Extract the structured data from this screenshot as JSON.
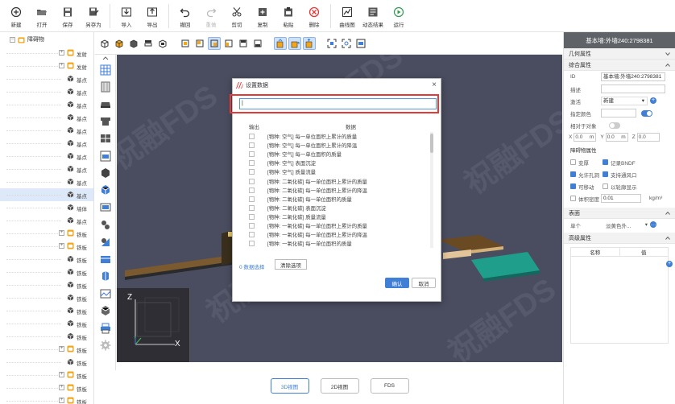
{
  "toolbar": [
    {
      "label": "新建",
      "icon": "plus-circle-icon",
      "disabled": false
    },
    {
      "label": "打开",
      "icon": "folder-open-icon",
      "disabled": false
    },
    {
      "label": "保存",
      "icon": "save-icon",
      "disabled": false
    },
    {
      "label": "另存为",
      "icon": "save-as-icon",
      "disabled": false
    },
    {
      "label": "导入",
      "icon": "import-icon",
      "disabled": false
    },
    {
      "label": "导出",
      "icon": "export-icon",
      "disabled": false
    },
    {
      "label": "撤回",
      "icon": "undo-icon",
      "disabled": false
    },
    {
      "label": "重做",
      "icon": "redo-icon",
      "disabled": true
    },
    {
      "label": "剪切",
      "icon": "scissors-icon",
      "disabled": false
    },
    {
      "label": "复制",
      "icon": "copy-icon",
      "disabled": false
    },
    {
      "label": "粘贴",
      "icon": "paste-icon",
      "disabled": false
    },
    {
      "label": "删除",
      "icon": "delete-icon",
      "disabled": false
    },
    {
      "label": "曲线图",
      "icon": "line-chart-icon",
      "disabled": false
    },
    {
      "label": "动态结果",
      "icon": "dynamic-result-icon",
      "disabled": false
    },
    {
      "label": "运行",
      "icon": "play-icon",
      "disabled": false
    }
  ],
  "tree": {
    "root_label": "障碍物",
    "rows": [
      {
        "label": "发射",
        "kind": "group"
      },
      {
        "label": "发射",
        "kind": "group"
      },
      {
        "label": "基点",
        "kind": "item"
      },
      {
        "label": "基点",
        "kind": "item"
      },
      {
        "label": "基点",
        "kind": "item"
      },
      {
        "label": "基点",
        "kind": "item"
      },
      {
        "label": "基点",
        "kind": "item"
      },
      {
        "label": "基点",
        "kind": "item"
      },
      {
        "label": "基点",
        "kind": "item"
      },
      {
        "label": "基点",
        "kind": "item"
      },
      {
        "label": "基点",
        "kind": "item"
      },
      {
        "label": "基点",
        "kind": "item"
      },
      {
        "label": "墙体",
        "kind": "item"
      },
      {
        "label": "基点",
        "kind": "item"
      },
      {
        "label": "铁板",
        "kind": "group"
      },
      {
        "label": "铁板",
        "kind": "group"
      },
      {
        "label": "铁板",
        "kind": "item"
      },
      {
        "label": "铁板",
        "kind": "item"
      },
      {
        "label": "铁板",
        "kind": "item"
      },
      {
        "label": "铁板",
        "kind": "item"
      },
      {
        "label": "铁板",
        "kind": "item"
      },
      {
        "label": "铁板",
        "kind": "item"
      },
      {
        "label": "铁板",
        "kind": "item"
      },
      {
        "label": "铁板",
        "kind": "group"
      },
      {
        "label": "铁板",
        "kind": "item"
      },
      {
        "label": "铁板",
        "kind": "group"
      },
      {
        "label": "铁板",
        "kind": "group"
      },
      {
        "label": "铁板",
        "kind": "group"
      }
    ],
    "selected_index": 11
  },
  "view_tabs": [
    {
      "label": "3D视图",
      "active": true
    },
    {
      "label": "2D视图",
      "active": false
    },
    {
      "label": "FDS",
      "active": false
    }
  ],
  "gizmo": {
    "z": "Z",
    "x": "X",
    "y": "Y"
  },
  "watermark": "祝融FDS",
  "props": {
    "title": "基本墙:外墙240:2798381",
    "sections": {
      "geometry": "几何属性",
      "general": "综合属性",
      "obstacle": "障碍物属性",
      "surface": "表面",
      "advanced": "高级属性"
    },
    "id_label": "ID",
    "id_value": "基本墙:外墙240:2798381",
    "desc_label": "描述",
    "activate_label": "激活",
    "activate_value": "新建",
    "color_label": "指定颜色",
    "relative_label": "相对于对象",
    "x_label": "X",
    "x_value": "0.0",
    "x_unit": "m",
    "y_label": "Y",
    "y_value": "0.0",
    "y_unit": "m",
    "z_label": "Z",
    "z_value": "0.0",
    "checks": [
      {
        "label": "变厚",
        "on": false
      },
      {
        "label": "记录BNDF",
        "on": true
      },
      {
        "label": "允许孔洞",
        "on": true
      },
      {
        "label": "支持通风口",
        "on": true
      },
      {
        "label": "可移动",
        "on": true
      },
      {
        "label": "以轮廓显示",
        "on": false
      }
    ],
    "volume_label": "体积密度",
    "volume_value": "0.01",
    "volume_unit": "kg/m³",
    "single_label": "单个",
    "single_value": "淡黄色外...",
    "adv_col_name": "名称",
    "adv_col_value": "值"
  },
  "dialog": {
    "title": "设置数据",
    "search_value": "|",
    "col_output": "输出",
    "col_data": "数据",
    "rows": [
      "[物种: 空气] 每一单位面积上累计的质量",
      "[物种: 空气] 每一单位面积上累计的降温",
      "[物种: 空气] 每一单位面积的质量",
      "[物种: 空气] 表面沉淀",
      "[物种: 空气] 质量流量",
      "[物种: 二氧化碳] 每一单位面积上累计的质量",
      "[物种: 二氧化碳] 每一单位面积上累计的降温",
      "[物种: 二氧化碳] 每一单位面积的质量",
      "[物种: 二氧化碳] 表面沉淀",
      "[物种: 二氧化碳] 质量流量",
      "[物种: 一氧化碳] 每一单位面积上累计的质量",
      "[物种: 一氧化碳] 每一单位面积上累计的降温",
      "[物种: 一氧化碳] 每一单位面积的质量"
    ],
    "selected_count": "0 数据选择",
    "clear_label": "清除选项",
    "ok_label": "确认",
    "cancel_label": "取消"
  }
}
